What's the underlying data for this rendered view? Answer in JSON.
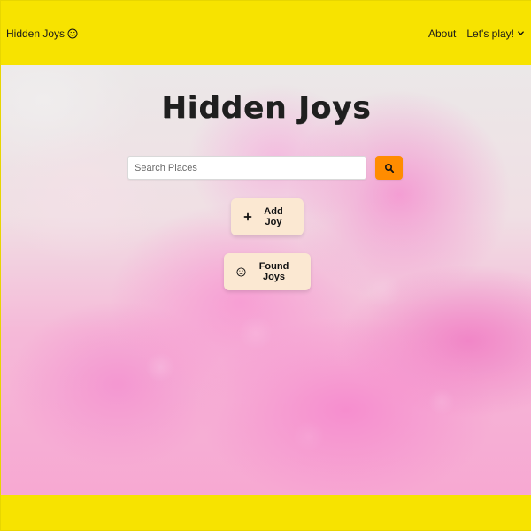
{
  "navbar": {
    "brand_label": "Hidden Joys",
    "brand_icon": "smile-icon",
    "links": [
      {
        "label": "About"
      },
      {
        "label": "Let's play!",
        "icon": "chevron-down-icon"
      }
    ]
  },
  "hero": {
    "title": "Hidden Joys"
  },
  "search": {
    "placeholder": "Search Places",
    "button_icon": "search-icon",
    "button_color": "#ff8c00"
  },
  "actions": {
    "add_joy": {
      "label": "Add Joy",
      "icon": "plus-icon"
    },
    "found_joys": {
      "label": "Found Joys",
      "icon": "smile-icon"
    }
  },
  "colors": {
    "brand_yellow": "#f7e300",
    "button_cream": "#fbe8d2",
    "search_orange": "#ff8c00"
  }
}
